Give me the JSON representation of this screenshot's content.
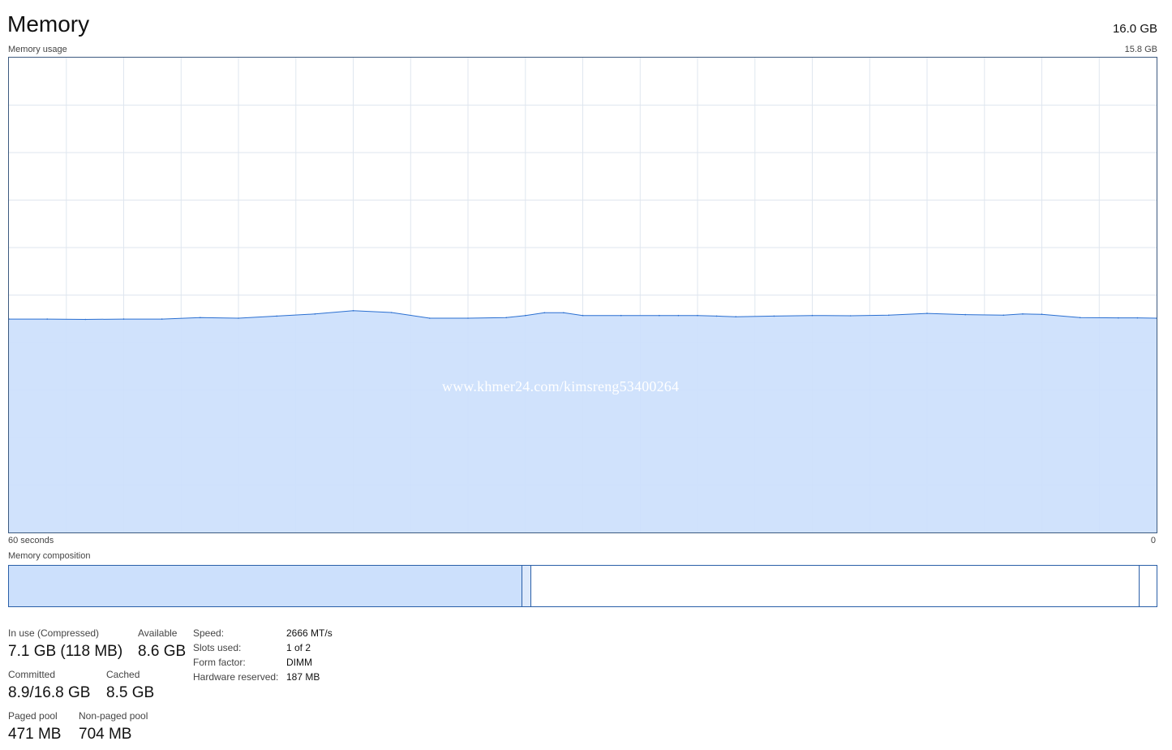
{
  "header": {
    "title": "Memory",
    "total_memory": "16.0 GB"
  },
  "usage_graph": {
    "label": "Memory usage",
    "max_label": "15.8 GB",
    "x_left_label": "60 seconds",
    "x_right_label": "0",
    "fill_color": "#cce0fc",
    "line_color": "#2a6fd1",
    "grid_color": "#dfe6ef",
    "watermark": "www.khmer24.com/kimsreng53400264"
  },
  "chart_data": {
    "type": "area",
    "xlabel": "",
    "ylabel": "",
    "xlim": [
      60,
      0
    ],
    "ylim": [
      0,
      15.8
    ],
    "grid": true,
    "x": [
      60,
      58,
      56,
      54,
      52,
      50,
      48,
      46,
      44,
      42,
      40,
      38,
      36,
      34,
      33,
      32,
      31,
      30,
      28,
      26,
      25,
      24,
      23,
      22,
      20,
      18,
      16,
      14,
      12,
      10,
      8,
      7,
      6,
      4,
      2,
      1,
      0
    ],
    "series": [
      {
        "values": [
          7.1,
          7.1,
          7.09,
          7.1,
          7.1,
          7.15,
          7.13,
          7.2,
          7.27,
          7.38,
          7.32,
          7.13,
          7.13,
          7.15,
          7.22,
          7.31,
          7.31,
          7.22,
          7.22,
          7.22,
          7.22,
          7.22,
          7.2,
          7.18,
          7.2,
          7.22,
          7.21,
          7.23,
          7.29,
          7.25,
          7.23,
          7.27,
          7.26,
          7.15,
          7.14,
          7.14,
          7.13
        ]
      }
    ]
  },
  "composition": {
    "label": "Memory composition",
    "in_use_fraction": 0.447,
    "modified_fraction": 0.008,
    "standby_fraction": 0.53,
    "free_fraction": 0.015
  },
  "stats": {
    "in_use_label": "In use (Compressed)",
    "in_use_value": "7.1 GB (118 MB)",
    "available_label": "Available",
    "available_value": "8.6 GB",
    "committed_label": "Committed",
    "committed_value": "8.9/16.8 GB",
    "cached_label": "Cached",
    "cached_value": "8.5 GB",
    "paged_pool_label": "Paged pool",
    "paged_pool_value": "471 MB",
    "non_paged_pool_label": "Non-paged pool",
    "non_paged_pool_value": "704 MB"
  },
  "specs": {
    "speed_label": "Speed:",
    "speed_value": "2666 MT/s",
    "slots_label": "Slots used:",
    "slots_value": "1 of 2",
    "form_label": "Form factor:",
    "form_value": "DIMM",
    "reserved_label": "Hardware reserved:",
    "reserved_value": "187 MB"
  }
}
